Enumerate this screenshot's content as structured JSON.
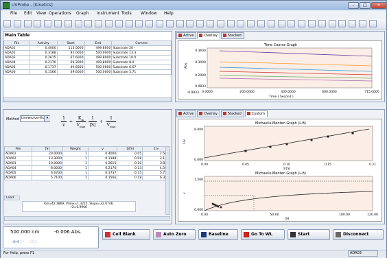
{
  "window": {
    "title": "UVProbe - [Kinetics]"
  },
  "menu": [
    "File",
    "Edit",
    "View",
    "Operations",
    "Graph",
    "Instrument",
    "Tools",
    "Window",
    "Help"
  ],
  "main_table": {
    "title": "Main Table",
    "headers": [
      "File",
      "Activity",
      "Start",
      "End",
      "Comme"
    ],
    "rows": [
      [
        "ADA01",
        "0.4000",
        "115.0000",
        "499.8000",
        "Substrate 20 -"
      ],
      [
        "ADA02",
        "0.3188",
        "92.0000",
        "500.0000",
        "Substrate 13.3"
      ],
      [
        "ADA03",
        "0.2615",
        "67.6000",
        "499.8000",
        "Substrate 10.0"
      ],
      [
        "ADA04",
        "0.2176",
        "50.2000",
        "499.8000",
        "Substrate 8.0"
      ],
      [
        "ADA05",
        "0.1737",
        "49.6000",
        "500.0000",
        "Substrate 6.67"
      ],
      [
        "ADA06",
        "0.1566",
        "49.6000",
        "500.0000",
        "Substrate 5.71"
      ]
    ]
  },
  "top_tabs": [
    "Active",
    "Overlay",
    "Stacked"
  ],
  "time_course": {
    "title": "Time Course Graph",
    "ylabel": "Abs.",
    "xlabel": "Time ( Second )",
    "yticks": [
      "0.3600",
      "0.3000",
      "0.2000",
      "0.0833",
      "-0.0833"
    ],
    "xticks": [
      "0.0000",
      "200.0000",
      "400.0000",
      "600.0000",
      "715.0000"
    ]
  },
  "method": {
    "label": "Method :",
    "value": "Lineweaver-Burk"
  },
  "equation": {
    "lhs_num": "1",
    "lhs_den": "v",
    "eq": "=",
    "km": "K",
    "km_sub": "m",
    "vmax": "V",
    "vmax_sub": "max",
    "s": "[S]",
    "plus": "+",
    "rhs_num": "1",
    "rhs_den": "V",
    "rhs_den_sub": "max"
  },
  "kin_table": {
    "headers": [
      "File",
      "[S]",
      "Weight",
      "v",
      "1/[S]",
      "1/v"
    ],
    "rows": [
      [
        "ADA01",
        "20.0000",
        "1",
        "0.4000",
        "0.05",
        "2.500"
      ],
      [
        "ADA02",
        "13.3000",
        "1",
        "0.3188",
        "0.08",
        "3.137"
      ],
      [
        "ADA03",
        "10.0000",
        "1",
        "0.2615",
        "0.10",
        "3.823"
      ],
      [
        "ADA04",
        "8.0000",
        "1",
        "0.2176",
        "0.13",
        "4.595"
      ],
      [
        "ADA05",
        "6.6700",
        "1",
        "0.1737",
        "0.15",
        "5.757"
      ],
      [
        "ADA06",
        "5.7100",
        "1",
        "0.1566",
        "0.18",
        "6.386"
      ]
    ],
    "load_label": "Load",
    "result": "Km=42.3869, Vmax=1.3215, Slope=32.0746,",
    "result2": "r2=0.9906"
  },
  "bottom_tabs": [
    "Active",
    "Overlay",
    "Stacked",
    "Custom"
  ],
  "lb_graph": {
    "title": "Michaelis-Menten Graph (L-B)",
    "ylabel": "1/v",
    "xlabel": "1/[S]",
    "yticks": [
      "8.000",
      "0.000"
    ],
    "xticks": [
      "0.00",
      "0.05",
      "0.10",
      "0.15",
      "0.21"
    ]
  },
  "mm_graph": {
    "title": "Michaelis-Menten Graph (L-B)",
    "ylabel": "v",
    "xlabel": "[S]",
    "yticks": [
      "1.500",
      "0.000"
    ],
    "xticks": [
      "0.00",
      "50.00",
      "100.00",
      "120.00"
    ]
  },
  "readout": {
    "wavelength": "500.000 nm",
    "abs": "-0.006 Abs."
  },
  "buttons": [
    "Cell Blank",
    "Auto Zero",
    "Baseline",
    "Go To WL",
    "Start",
    "Disconnect"
  ],
  "status": {
    "left": "For Help, press F1",
    "right": "ADA03"
  },
  "colors": {
    "graph_bg": "#fbeee6",
    "accent": "#b33333"
  }
}
